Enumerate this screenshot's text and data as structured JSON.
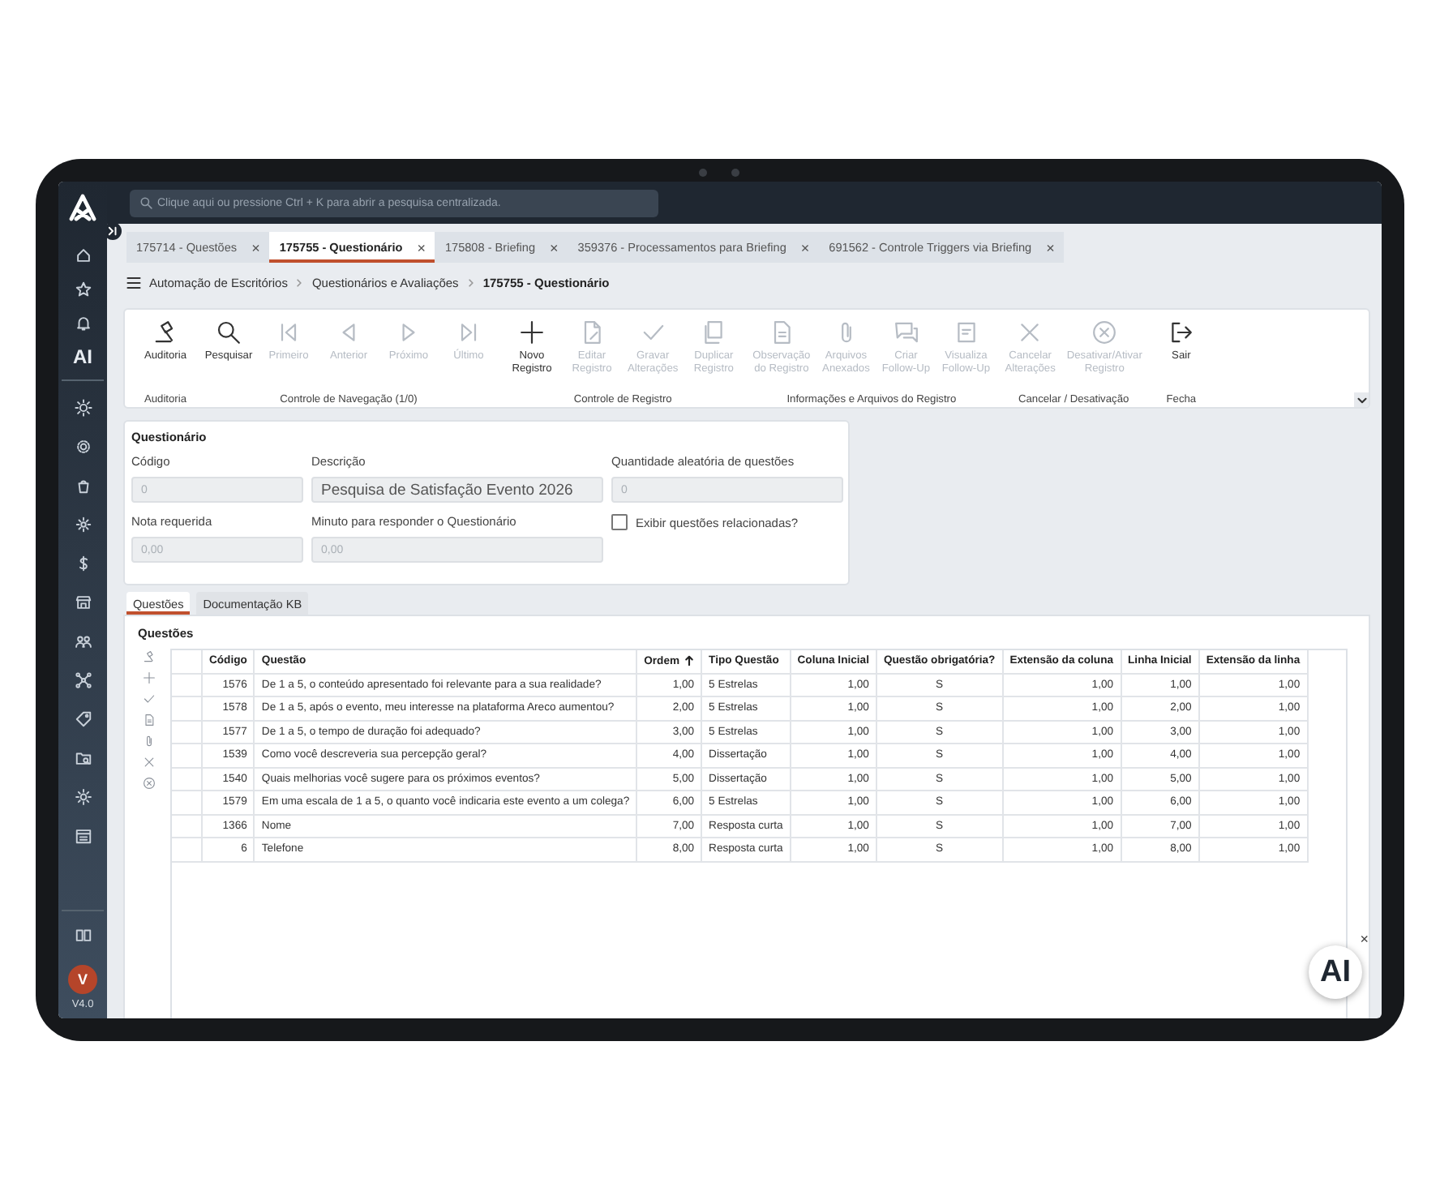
{
  "search": {
    "placeholder": "Clique aqui ou pressione Ctrl + K para abrir a pesquisa centralizada."
  },
  "sidebar": {
    "ai_label": "AI",
    "avatar": "V",
    "version": "V4.0"
  },
  "tabs": [
    {
      "label": "175714 - Questões",
      "selected": false
    },
    {
      "label": "175755 - Questionário",
      "selected": true
    },
    {
      "label": "175808 - Briefing",
      "selected": false
    },
    {
      "label": "359376 - Processamentos para Briefing",
      "selected": false
    },
    {
      "label": "691562 - Controle Triggers via Briefing",
      "selected": false
    }
  ],
  "breadcrumb": [
    "Automação de Escritórios",
    "Questionários e Avaliações",
    "175755 - Questionário"
  ],
  "toolbar": {
    "groups": [
      {
        "label": "Auditoria",
        "buttons": [
          {
            "lines": [
              "Auditoria"
            ],
            "disabled": false
          }
        ]
      },
      {
        "label": "Controle de Navegação (1/0)",
        "buttons": [
          {
            "lines": [
              "Pesquisar"
            ],
            "disabled": false
          },
          {
            "lines": [
              "Primeiro"
            ],
            "disabled": true
          },
          {
            "lines": [
              "Anterior"
            ],
            "disabled": true
          },
          {
            "lines": [
              "Próximo"
            ],
            "disabled": true
          },
          {
            "lines": [
              "Último"
            ],
            "disabled": true
          }
        ]
      },
      {
        "label": "Controle de Registro",
        "buttons": [
          {
            "lines": [
              "Novo",
              "Registro"
            ],
            "disabled": false
          },
          {
            "lines": [
              "Editar",
              "Registro"
            ],
            "disabled": true
          },
          {
            "lines": [
              "Gravar",
              "Alterações"
            ],
            "disabled": true
          },
          {
            "lines": [
              "Duplicar",
              "Registro"
            ],
            "disabled": true
          }
        ]
      },
      {
        "label": "Informações e Arquivos do Registro",
        "buttons": [
          {
            "lines": [
              "Observação",
              "do Registro"
            ],
            "disabled": true
          },
          {
            "lines": [
              "Arquivos",
              "Anexados"
            ],
            "disabled": true
          },
          {
            "lines": [
              "Criar",
              "Follow-Up"
            ],
            "disabled": true
          },
          {
            "lines": [
              "Visualiza",
              "Follow-Up"
            ],
            "disabled": true
          }
        ]
      },
      {
        "label": "Cancelar / Desativação",
        "buttons": [
          {
            "lines": [
              "Cancelar",
              "Alterações"
            ],
            "disabled": true
          },
          {
            "lines": [
              "Desativar/Ativar",
              "Registro"
            ],
            "disabled": true
          }
        ]
      },
      {
        "label": "Fecha",
        "buttons": [
          {
            "lines": [
              "Sair"
            ],
            "disabled": false
          }
        ]
      }
    ]
  },
  "form": {
    "title": "Questionário",
    "fields": [
      {
        "kind": "number",
        "label": "Código",
        "value": "0",
        "disabled": true
      },
      {
        "kind": "text",
        "label": "Descrição",
        "value": "Pesquisa de Satisfação Evento 2026",
        "disabled": false
      },
      {
        "kind": "number",
        "label": "Quantidade aleatória de questões",
        "value": "0",
        "disabled": true
      },
      {
        "kind": "number",
        "label": "Nota requerida",
        "value": "0,00",
        "disabled": true
      },
      {
        "kind": "number",
        "label": "Minuto para responder o Questionário",
        "value": "0,00",
        "disabled": true
      },
      {
        "kind": "checkbox",
        "label": "Exibir questões relacionadas?",
        "checked": false
      }
    ]
  },
  "subtabs": [
    {
      "label": "Questões",
      "selected": true
    },
    {
      "label": "Documentação KB",
      "selected": false
    }
  ],
  "questions": {
    "title": "Questões",
    "columns": [
      {
        "label": "Código",
        "sorted": false
      },
      {
        "label": "Questão",
        "sorted": false
      },
      {
        "label": "Ordem",
        "sorted": true
      },
      {
        "label": "Tipo Questão",
        "sorted": false
      },
      {
        "label": "Coluna Inicial",
        "sorted": false
      },
      {
        "label": "Questão obrigatória?",
        "sorted": false
      },
      {
        "label": "Extensão da coluna",
        "sorted": false
      },
      {
        "label": "Linha Inicial",
        "sorted": false
      },
      {
        "label": "Extensão da linha",
        "sorted": false
      }
    ],
    "rows": [
      [
        "1576",
        "De 1 a 5, o conteúdo apresentado foi relevante para a sua realidade?",
        "1,00",
        "5 Estrelas",
        "1,00",
        "S",
        "1,00",
        "1,00",
        "1,00"
      ],
      [
        "1578",
        "De 1 a 5, após o evento, meu interesse na plataforma Areco aumentou?",
        "2,00",
        "5 Estrelas",
        "1,00",
        "S",
        "1,00",
        "2,00",
        "1,00"
      ],
      [
        "1577",
        "De 1 a 5, o tempo de duração foi adequado?",
        "3,00",
        "5 Estrelas",
        "1,00",
        "S",
        "1,00",
        "3,00",
        "1,00"
      ],
      [
        "1539",
        "Como você descreveria sua percepção geral?",
        "4,00",
        "Dissertação",
        "1,00",
        "S",
        "1,00",
        "4,00",
        "1,00"
      ],
      [
        "1540",
        "Quais melhorias você sugere para os próximos eventos?",
        "5,00",
        "Dissertação",
        "1,00",
        "S",
        "1,00",
        "5,00",
        "1,00"
      ],
      [
        "1579",
        "Em uma escala de 1 a 5, o quanto você indicaria este evento a um colega?",
        "6,00",
        "5 Estrelas",
        "1,00",
        "S",
        "1,00",
        "6,00",
        "1,00"
      ],
      [
        "1366",
        "Nome",
        "7,00",
        "Resposta curta",
        "1,00",
        "S",
        "1,00",
        "7,00",
        "1,00"
      ],
      [
        "6",
        "Telefone",
        "8,00",
        "Resposta curta",
        "1,00",
        "S",
        "1,00",
        "8,00",
        "1,00"
      ]
    ]
  },
  "assistant": {
    "label": "AI",
    "close": "×"
  }
}
